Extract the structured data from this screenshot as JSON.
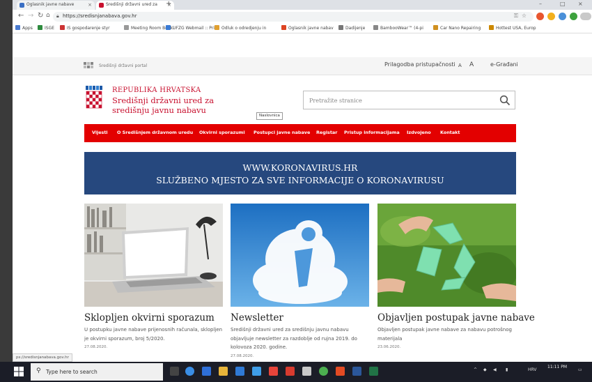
{
  "browser": {
    "tabs": [
      {
        "label": "Oglasnik javne nabave"
      },
      {
        "label": "Središnji državni ured za"
      }
    ],
    "url": "https://sredisnjanabava.gov.hr",
    "bookmarks": [
      {
        "label": "Apps",
        "color": "#4a7bd0"
      },
      {
        "label": "ISGE",
        "color": "#2e8b3e"
      },
      {
        "label": "IS gospodarenje styr",
        "color": "#cc3333"
      },
      {
        "label": "Meeting Room Booki",
        "color": "#999999"
      },
      {
        "label": "UFZG Webmail :: Pri",
        "color": "#3a7bd5"
      },
      {
        "label": "Odluk o odredjenju in",
        "color": "#e0a030"
      },
      {
        "label": "Oglasnik javne nabav",
        "color": "#dd4422"
      },
      {
        "label": "Dadijenje",
        "color": "#777777"
      },
      {
        "label": "BambooWear™ (4-pi",
        "color": "#888888"
      },
      {
        "label": "Car Nano Repairing",
        "color": "#d09020"
      },
      {
        "label": "Hottest USA, Europ",
        "color": "#cc8800"
      }
    ]
  },
  "site": {
    "portal_label": "Središnji državni portal",
    "accessibility_label": "Prilagodba pristupačnosti",
    "font_small": "A",
    "font_large": "A",
    "egradani": "e-Građani",
    "country": "REPUBLIKA HRVATSKA",
    "office_line1": "Središnji državni ured za",
    "office_line2": "središnju javnu nabavu",
    "search_placeholder": "Pretražite stranice",
    "tooltip": "Naslovnica",
    "nav": [
      "Vijesti",
      "O Središnjem državnom uredu",
      "Okvirni sporazumi",
      "Postupci javne nabave",
      "Registar",
      "Pristup informacijama",
      "Izdvojeno",
      "Kontakt"
    ],
    "banner_line1": "WWW.KORONAVIRUS.HR",
    "banner_line2": "SLUŽBENO MJESTO ZA SVE INFORMACIJE O KORONAVIRUSU",
    "cards": [
      {
        "title": "Sklopljen okvirni sporazum",
        "text": "U postupku javne nabave prijenosnih računala, sklopljen je okvirni sporazum, broj 5/2020.",
        "date": "27.08.2020."
      },
      {
        "title": "Newsletter",
        "text": "Središnji državni ured za središnju javnu nabavu objavljuje newsletter za razdoblje od rujna 2019. do kolovoza 2020. godine.",
        "date": "27.08.2020."
      },
      {
        "title": "Objavljen postupak javne nabave",
        "text": "Objavljen postupak javne nabave za nabavu potrošnog materijala",
        "date": "23.06.2020."
      }
    ]
  },
  "status_url": "ps://sredisnjanabava.gov.hr",
  "taskbar": {
    "search_placeholder": "Type here to search",
    "time": "11:11 PM",
    "lang": "HRV"
  },
  "colors": {
    "brand_red": "#e30000",
    "header_red": "#c8102e",
    "banner_blue": "#26487e"
  }
}
